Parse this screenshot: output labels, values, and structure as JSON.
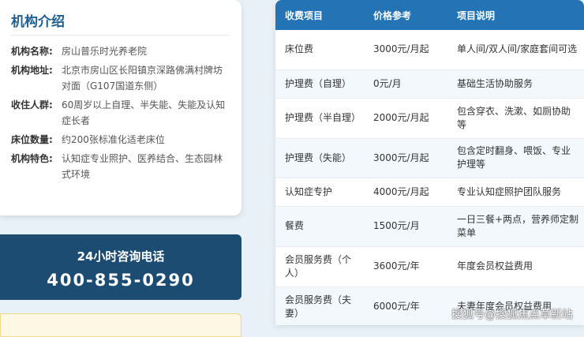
{
  "intro": {
    "title": "机构介绍",
    "rows": [
      {
        "label": "机构名称:",
        "value": "房山普乐时光养老院"
      },
      {
        "label": "机构地址:",
        "value": "北京市房山区长阳镇京深路佛满村牌坊对面（G107国道东侧）"
      },
      {
        "label": "收住人群:",
        "value": "60周岁以上自理、半失能、失能及认知症长者"
      },
      {
        "label": "床位数量:",
        "value": "约200张标准化适老床位"
      },
      {
        "label": "机构特色:",
        "value": "认知症专业照护、医养结合、生态园林式环境"
      }
    ]
  },
  "phone": {
    "title": "24小时咨询电话",
    "number": "400-855-0290"
  },
  "fees": {
    "headers": [
      "收费项目",
      "价格参考",
      "项目说明"
    ],
    "rows": [
      {
        "item": "床位费",
        "price": "3000元/月起",
        "desc": "单人间/双人间/家庭套间可选"
      },
      {
        "item": "护理费（自理）",
        "price": "0元/月",
        "desc": "基础生活协助服务"
      },
      {
        "item": "护理费（半自理）",
        "price": "2000元/月起",
        "desc": "包含穿衣、洗漱、如厕协助等"
      },
      {
        "item": "护理费（失能）",
        "price": "3000元/月起",
        "desc": "包含定时翻身、喂饭、专业护理等"
      },
      {
        "item": "认知症专护",
        "price": "4000元/月起",
        "desc": "专业认知症照护团队服务"
      },
      {
        "item": "餐费",
        "price": "1500元/月",
        "desc": "一日三餐+两点，营养师定制菜单"
      },
      {
        "item": "会员服务费（个人）",
        "price": "3600元/年",
        "desc": "年度会员权益费用"
      },
      {
        "item": "会员服务费（夫妻）",
        "price": "6000元/年",
        "desc": "夫妻年度会员权益费用"
      }
    ]
  },
  "watermark": "搜狐号@搜狐焦点草新站"
}
